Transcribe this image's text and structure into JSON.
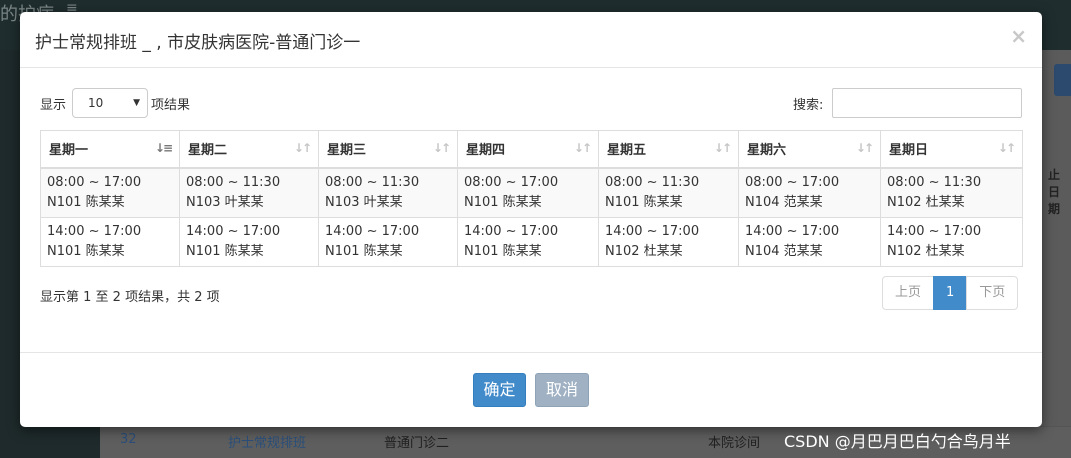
{
  "background": {
    "brand": "的护病",
    "menu_icon": "≡",
    "side_text": "止日期",
    "row": {
      "id": "32",
      "link": "护士常规排班",
      "dept": "普通门诊二",
      "type": "本院诊间"
    }
  },
  "modal": {
    "title": "护士常规排班 _ , 市皮肤病医院-普通门诊一",
    "close": "×",
    "length": {
      "prefix": "显示",
      "value": "10",
      "suffix": "项结果"
    },
    "search": {
      "label": "搜索:",
      "value": ""
    },
    "columns": [
      "星期一",
      "星期二",
      "星期三",
      "星期四",
      "星期五",
      "星期六",
      "星期日"
    ],
    "rows": [
      [
        {
          "time": "08:00 ~ 17:00",
          "nurse": "N101 陈某某"
        },
        {
          "time": "08:00 ~ 11:30",
          "nurse": "N103 叶某某"
        },
        {
          "time": "08:00 ~ 11:30",
          "nurse": "N103 叶某某"
        },
        {
          "time": "08:00 ~ 17:00",
          "nurse": "N101 陈某某"
        },
        {
          "time": "08:00 ~ 11:30",
          "nurse": "N101 陈某某"
        },
        {
          "time": "08:00 ~ 17:00",
          "nurse": "N104 范某某"
        },
        {
          "time": "08:00 ~ 11:30",
          "nurse": "N102 杜某某"
        }
      ],
      [
        {
          "time": "14:00 ~ 17:00",
          "nurse": "N101 陈某某"
        },
        {
          "time": "14:00 ~ 17:00",
          "nurse": "N101 陈某某"
        },
        {
          "time": "14:00 ~ 17:00",
          "nurse": "N101 陈某某"
        },
        {
          "time": "14:00 ~ 17:00",
          "nurse": "N101 陈某某"
        },
        {
          "time": "14:00 ~ 17:00",
          "nurse": "N102 杜某某"
        },
        {
          "time": "14:00 ~ 17:00",
          "nurse": "N104 范某某"
        },
        {
          "time": "14:00 ~ 17:00",
          "nurse": "N102 杜某某"
        }
      ]
    ],
    "info": "显示第 1 至 2 项结果，共 2 项",
    "pagination": {
      "prev": "上页",
      "current": "1",
      "next": "下页"
    },
    "buttons": {
      "ok": "确定",
      "cancel": "取消"
    }
  },
  "watermark": "CSDN @月巴月巴白勺合鸟月半",
  "colors": {
    "primary": "#428bca",
    "cancel": "#9fb1c3",
    "border": "#dddddd"
  }
}
